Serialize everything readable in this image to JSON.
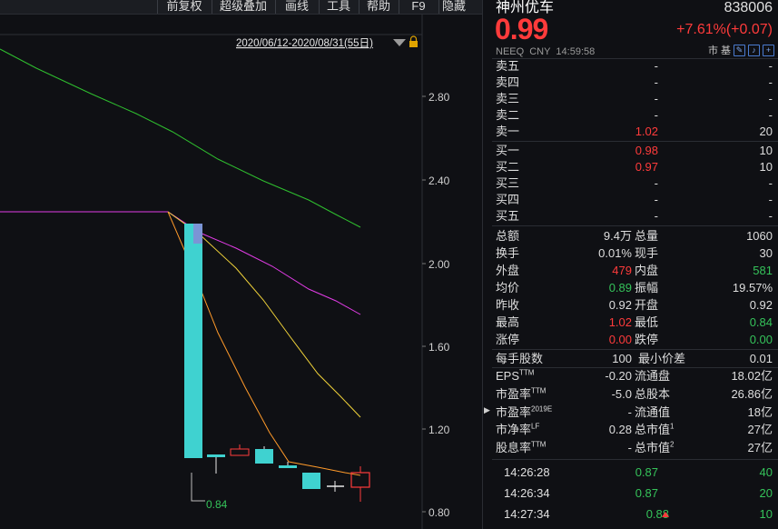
{
  "toolbar": {
    "buttons": [
      "前复权",
      "超级叠加",
      "画线",
      "工具",
      "帮助",
      "F9",
      "隐藏"
    ]
  },
  "chart": {
    "range_label": "2020/06/12-2020/08/31(55日)",
    "y_ticks": [
      "2.80",
      "2.40",
      "2.00",
      "1.60",
      "1.20",
      "0.80"
    ],
    "min_label": "0.84",
    "colors": {
      "up": "#ff3b3b",
      "down": "#3fd2d0",
      "ma_yellow": "#f0d23a",
      "ma_magenta": "#e23ce6",
      "ma_green": "#2fbf2f",
      "ma_orange": "#ff9a2a"
    }
  },
  "quote": {
    "name": "神州优车",
    "code": "838006",
    "price": "0.99",
    "change": "+7.61%(+0.07)",
    "exchange": "NEEQ",
    "currency": "CNY",
    "time": "14:59:58",
    "icons_label": "市 基"
  },
  "order_book": {
    "asks": [
      {
        "label": "卖五",
        "price": "-",
        "vol": "-"
      },
      {
        "label": "卖四",
        "price": "-",
        "vol": "-"
      },
      {
        "label": "卖三",
        "price": "-",
        "vol": "-"
      },
      {
        "label": "卖二",
        "price": "-",
        "vol": "-"
      },
      {
        "label": "卖一",
        "price": "1.02",
        "vol": "20"
      }
    ],
    "bids": [
      {
        "label": "买一",
        "price": "0.98",
        "vol": "10"
      },
      {
        "label": "买二",
        "price": "0.97",
        "vol": "10"
      },
      {
        "label": "买三",
        "price": "-",
        "vol": "-"
      },
      {
        "label": "买四",
        "price": "-",
        "vol": "-"
      },
      {
        "label": "买五",
        "price": "-",
        "vol": "-"
      }
    ]
  },
  "stats": [
    {
      "l1": "总额",
      "v1": "9.4万",
      "l2": "总量",
      "v2": "1060"
    },
    {
      "l1": "换手",
      "v1": "0.01%",
      "l2": "现手",
      "v2": "30"
    },
    {
      "l1": "外盘",
      "v1": "479",
      "l2": "内盘",
      "v2": "581"
    },
    {
      "l1": "均价",
      "v1": "0.89",
      "l2": "振幅",
      "v2": "19.57%"
    },
    {
      "l1": "昨收",
      "v1": "0.92",
      "l2": "开盘",
      "v2": "0.92"
    },
    {
      "l1": "最高",
      "v1": "1.02",
      "l2": "最低",
      "v2": "0.84"
    },
    {
      "l1": "涨停",
      "v1": "0.00",
      "l2": "跌停",
      "v2": "0.00"
    }
  ],
  "lot": {
    "l1": "每手股数",
    "v1": "100",
    "l2": "最小价差",
    "v2": "0.01"
  },
  "fundamentals": [
    {
      "l1": "EPS",
      "s1": "TTM",
      "v1": "-0.20",
      "l2": "流通盘",
      "s2": "",
      "v2": "18.02亿"
    },
    {
      "l1": "市盈率",
      "s1": "TTM",
      "v1": "-5.0",
      "l2": "总股本",
      "s2": "",
      "v2": "26.86亿"
    },
    {
      "l1": "市盈率",
      "s1": "2019E",
      "v1": "-",
      "l2": "流通值",
      "s2": "",
      "v2": "18亿"
    },
    {
      "l1": "市净率",
      "s1": "LF",
      "v1": "0.28",
      "l2": "总市值",
      "s2": "1",
      "v2": "27亿"
    },
    {
      "l1": "股息率",
      "s1": "TTM",
      "v1": "-",
      "l2": "总市值",
      "s2": "2",
      "v2": "27亿"
    }
  ],
  "ticks": [
    {
      "time": "14:26:28",
      "price": "0.87",
      "vol": "40"
    },
    {
      "time": "14:26:34",
      "price": "0.87",
      "vol": "20"
    },
    {
      "time": "14:27:34",
      "price": "0.88",
      "vol": "10"
    }
  ]
}
